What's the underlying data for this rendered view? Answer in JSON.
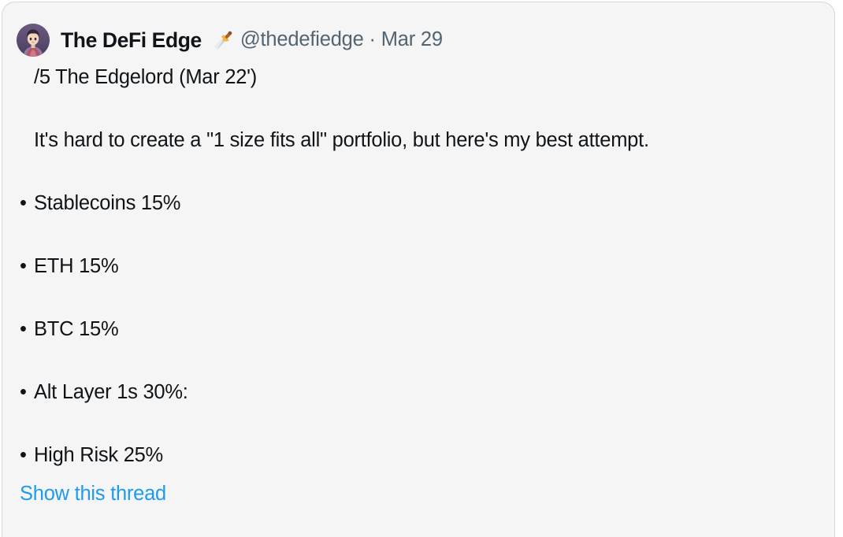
{
  "card": {
    "background": "#f5f5f5",
    "border_color": "#cfd9de"
  },
  "header": {
    "avatar_alt": "anime-avatar",
    "display_name": "The DeFi Edge",
    "emoji": "dagger-emoji",
    "handle_and_date": "@thedefiedge · Mar 29",
    "handle": "@thedefiedge",
    "separator": "·",
    "date": "Mar 29",
    "name_color": "#0f1419",
    "meta_color": "#536471"
  },
  "body": {
    "lines": [
      {
        "bullet": "",
        "text": "/5  The Edgelord (Mar 22')"
      },
      {
        "bullet": "",
        "text": "It's hard to create a \"1 size fits all\" portfolio, but here's my best attempt."
      },
      {
        "bullet": "•",
        "text": "Stablecoins 15%"
      },
      {
        "bullet": "•",
        "text": "ETH 15%"
      },
      {
        "bullet": "•",
        "text": "BTC 15%"
      },
      {
        "bullet": "•",
        "text": "Alt Layer 1s 30%:"
      },
      {
        "bullet": "•",
        "text": "High Risk 25%"
      }
    ]
  },
  "footer": {
    "show_thread_label": "Show this thread",
    "link_color": "#1d9bf0"
  }
}
